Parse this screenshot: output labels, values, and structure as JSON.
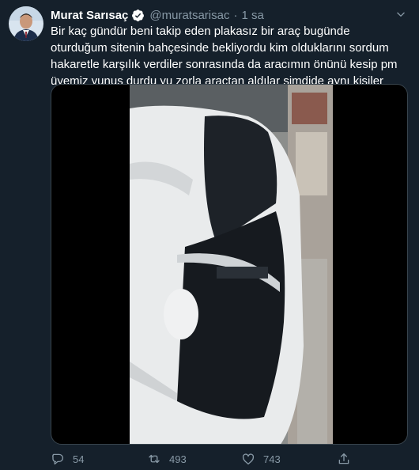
{
  "tweet": {
    "display_name": "Murat Sarısaç",
    "handle": "@muratsarisac",
    "separator": "·",
    "time": "1 sa",
    "text": "Bir kaç gündür beni takip eden plakasız bir araç bugünde oturduğum sitenin bahçesinde bekliyordu kim olduklarını sordum hakaretle karşılık verdiler sonrasında da aracımın önünü kesip pm üyemiz yunus durdu yu zorla araçtan aldılar şimdide aynı kişiler evimin önünde dolaşıyprlar",
    "stats": {
      "replies": "54",
      "retweets": "493",
      "likes": "743"
    }
  },
  "icons": {
    "verified": "verified-badge-icon",
    "caret": "chevron-down-icon",
    "reply": "reply-icon",
    "retweet": "retweet-icon",
    "like": "heart-icon",
    "share": "share-icon"
  },
  "colors": {
    "background": "#15202b",
    "accent": "#1da1f2",
    "secondary_text": "#8899a6",
    "border": "#38444d"
  }
}
